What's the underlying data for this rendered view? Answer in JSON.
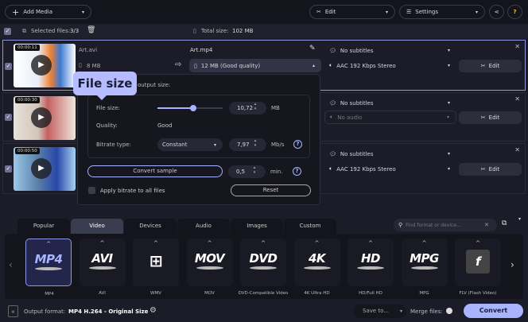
{
  "toolbar": {
    "add_media": "Add Media",
    "edit": "Edit",
    "settings": "Settings",
    "help": "?"
  },
  "subbar": {
    "selected_label": "Selected files:",
    "selected_value": "3/3",
    "total_label": "Total size:",
    "total_value": "102 MB"
  },
  "files": [
    {
      "duration": "00:00:11",
      "source_name": "Art.avi",
      "source_size": "8 MB",
      "output_name": "Art.mp4",
      "output_size": "12 MB (Good quality)",
      "subtitles": "No subtitles",
      "audio": "AAC 192 Kbps Stereo",
      "edit": "Edit"
    },
    {
      "duration": "00:00:30",
      "subtitles": "No subtitles",
      "audio": "No audio",
      "edit": "Edit"
    },
    {
      "duration": "00:00:50",
      "subtitles": "No subtitles",
      "audio": "AAC 192 Kbps Stereo",
      "edit": "Edit"
    }
  ],
  "popup": {
    "heading": "output size:",
    "file_size_label": "File size:",
    "file_size_value": "10,72",
    "file_size_unit": "MB",
    "file_size_slider_fraction": 0.55,
    "quality_label": "Quality:",
    "quality_value": "Good",
    "bitrate_label": "Bitrate type:",
    "bitrate_type": "Constant",
    "bitrate_value": "7,97",
    "bitrate_unit": "Mb/s",
    "convert_sample": "Convert sample",
    "sample_value": "0,5",
    "sample_unit": "min.",
    "apply_all": "Apply bitrate to all files",
    "reset": "Reset"
  },
  "tooltip": "File size",
  "tabs": [
    "Popular",
    "Video",
    "Devices",
    "Audio",
    "Images",
    "Custom"
  ],
  "active_tab": "Video",
  "search": {
    "placeholder": "Find format or device..."
  },
  "formats": [
    {
      "logo": "MP4",
      "label": "MP4"
    },
    {
      "logo": "AVI",
      "label": "AVI"
    },
    {
      "logo": "",
      "label": "WMV"
    },
    {
      "logo": "MOV",
      "label": "MOV"
    },
    {
      "logo": "DVD",
      "label": "DVD-Compatible Video"
    },
    {
      "logo": "4K",
      "label": "4K Ultra HD"
    },
    {
      "logo": "HD",
      "label": "HD/Full HD"
    },
    {
      "logo": "MPG",
      "label": "MPG"
    },
    {
      "logo": "f",
      "label": "FLV (Flash Video)"
    }
  ],
  "bottom": {
    "output_label": "Output format:",
    "output_value": "MP4 H.264 - Original Size",
    "save_to": "Save to...",
    "merge": "Merge files:",
    "convert": "Convert"
  },
  "colors": {
    "accent": "#a9b4ff",
    "background": "#1b1c27"
  }
}
